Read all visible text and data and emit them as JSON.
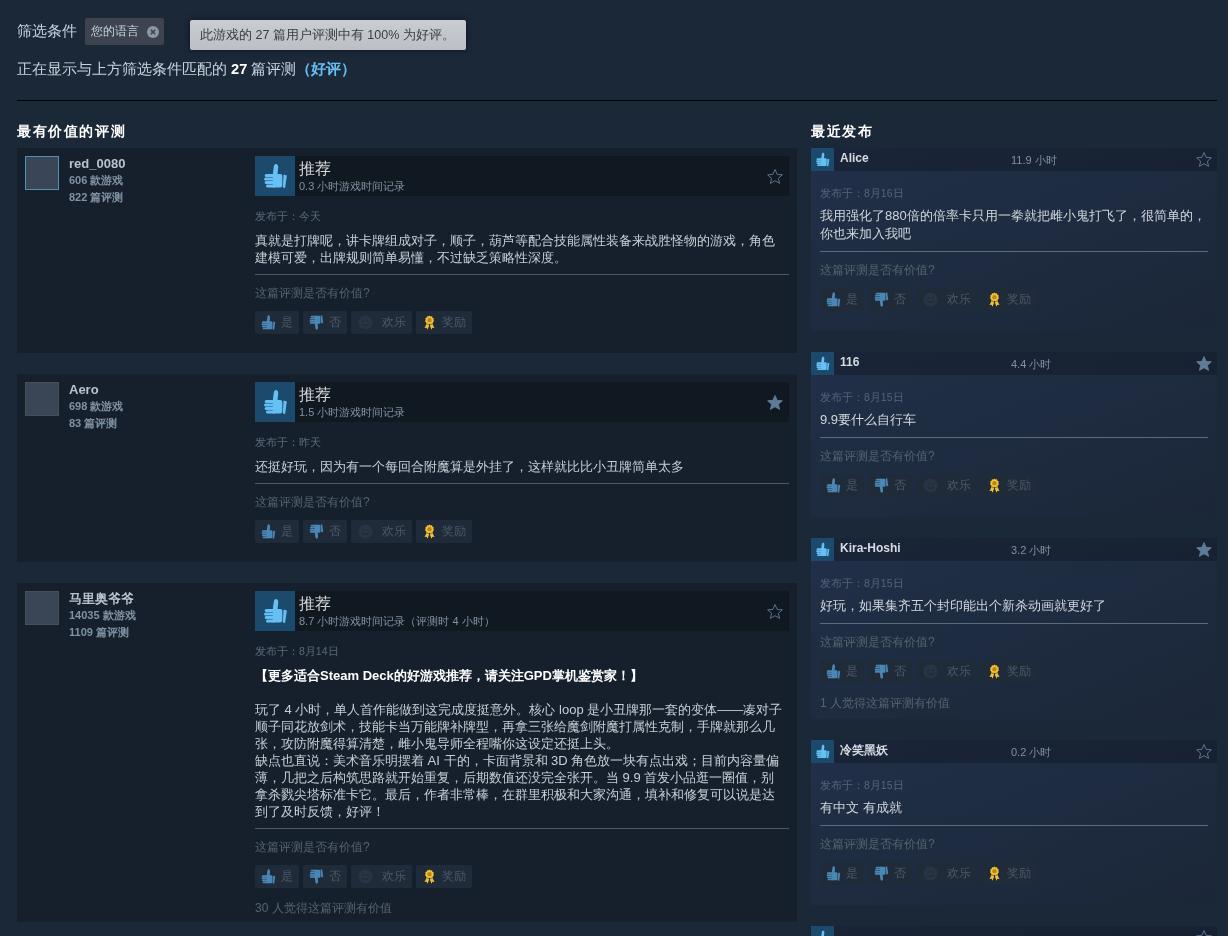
{
  "filter_bar": {
    "label": "筛选条件",
    "chips": [
      {
        "label": "您的语言"
      }
    ]
  },
  "tooltip": {
    "text": "此游戏的 27 篇用户评测中有 100% 为好评。"
  },
  "summary": {
    "text": "正在显示与上方筛选条件匹配的 **27** 篇评测",
    "score_link": "（好评）"
  },
  "most_helpful": {
    "heading": "最有价值的评测",
    "reviews": [
      {
        "author": {
          "name": "red_0080",
          "online": true,
          "games": "606 款游戏",
          "reviews": "822 篇评测"
        },
        "recommended": true,
        "verdict": "推荐",
        "playtime": "0.3 小时游戏时间记录",
        "starred": false,
        "posted": "发布于：今天",
        "paragraphs": [
          "真就是打牌呢，讲卡牌组成对子，顺子，葫芦等配合技能属性装备来战胜怪物的游戏，角色建模可爱，出牌规则简单易懂，不过缺乏策略性深度。"
        ],
        "question": "这篇评测是否有价值?",
        "buttons": [
          {
            "kind": "yes",
            "label": "是"
          },
          {
            "kind": "no",
            "label": "否"
          },
          {
            "kind": "funny",
            "label": "欢乐"
          },
          {
            "kind": "award",
            "label": "奖励"
          }
        ]
      },
      {
        "author": {
          "name": "Aero",
          "online": false,
          "games": "698 款游戏",
          "reviews": "83 篇评测"
        },
        "recommended": true,
        "verdict": "推荐",
        "playtime": "1.5 小时游戏时间记录",
        "starred": true,
        "posted": "发布于：昨天",
        "paragraphs": [
          "还挺好玩，因为有一个每回合附魔算是外挂了，这样就比比小丑牌简单太多"
        ],
        "question": "这篇评测是否有价值?",
        "buttons": [
          {
            "kind": "yes",
            "label": "是"
          },
          {
            "kind": "no",
            "label": "否"
          },
          {
            "kind": "funny",
            "label": "欢乐"
          },
          {
            "kind": "award",
            "label": "奖励"
          }
        ]
      },
      {
        "author": {
          "name": "马里奥爷爷",
          "online": false,
          "games": "14035 款游戏",
          "reviews": "1109 篇评测"
        },
        "recommended": true,
        "verdict": "推荐",
        "playtime": "8.7 小时游戏时间记录（评测时 4 小时）",
        "starred": false,
        "posted": "发布于：8月14日",
        "headline": "【更多适合Steam Deck的好游戏推荐，请关注GPD掌机鉴赏家！】",
        "paragraphs": [
          "玩了 4 小时，单人首作能做到这完成度挺意外。核心 loop 是小丑牌那一套的变体——凑对子顺子同花放剑术，技能卡当万能牌补牌型，再拿三张给魔剑附魔打属性克制，手牌就那么几张，攻防附魔得算清楚，雌小鬼导师全程嘴你这设定还挺上头。",
          "缺点也直说：美术音乐明摆着 AI 干的，卡面背景和 3D 角色放一块有点出戏；目前内容量偏薄，几把之后构筑思路就开始重复，后期数值还没完全张开。当 9.9 首发小品逛一圈值，别拿杀戮尖塔标准卡它。最后，作者非常棒，在群里积极和大家沟通，填补和修复可以说是达到了及时反馈，好评！"
        ],
        "question": "这篇评测是否有价值?",
        "buttons": [
          {
            "kind": "yes",
            "label": "是"
          },
          {
            "kind": "no",
            "label": "否"
          },
          {
            "kind": "funny",
            "label": "欢乐"
          },
          {
            "kind": "award",
            "label": "奖励"
          }
        ],
        "helpful_count": "30 人觉得这篇评测有价值"
      }
    ]
  },
  "recent": {
    "heading": "最近发布",
    "reviews": [
      {
        "author": "Alice",
        "recommended": true,
        "hours": "11.9 小时",
        "starred": false,
        "posted": "发布于：8月16日",
        "text": "我用强化了880倍的倍率卡只用一拳就把雌小鬼打飞了，很简单的，你也来加入我吧",
        "question": "这篇评测是否有价值?",
        "buttons": [
          {
            "kind": "yes",
            "label": "是"
          },
          {
            "kind": "no",
            "label": "否"
          },
          {
            "kind": "funny",
            "label": "欢乐"
          },
          {
            "kind": "award",
            "label": "奖励"
          }
        ]
      },
      {
        "author": "116",
        "recommended": true,
        "hours": "4.4 小时",
        "starred": true,
        "posted": "发布于：8月15日",
        "text": "9.9要什么自行车",
        "question": "这篇评测是否有价值?",
        "buttons": [
          {
            "kind": "yes",
            "label": "是"
          },
          {
            "kind": "no",
            "label": "否"
          },
          {
            "kind": "funny",
            "label": "欢乐"
          },
          {
            "kind": "award",
            "label": "奖励"
          }
        ]
      },
      {
        "author": "Kira-Hoshi",
        "recommended": true,
        "hours": "3.2 小时",
        "starred": true,
        "posted": "发布于：8月15日",
        "text": "好玩，如果集齐五个封印能出个新杀动画就更好了",
        "question": "这篇评测是否有价值?",
        "buttons": [
          {
            "kind": "yes",
            "label": "是"
          },
          {
            "kind": "no",
            "label": "否"
          },
          {
            "kind": "funny",
            "label": "欢乐"
          },
          {
            "kind": "award",
            "label": "奖励"
          }
        ],
        "helpful_count": "1 人觉得这篇评测有价值"
      },
      {
        "author": "冷笑黑妖",
        "recommended": true,
        "hours": "0.2 小时",
        "starred": false,
        "posted": "发布于：8月15日",
        "text": "有中文 有成就",
        "question": "这篇评测是否有价值?",
        "buttons": [
          {
            "kind": "yes",
            "label": "是"
          },
          {
            "kind": "no",
            "label": "否"
          },
          {
            "kind": "funny",
            "label": "欢乐"
          },
          {
            "kind": "award",
            "label": "奖励"
          }
        ]
      },
      {
        "recommended": true,
        "starred": false
      }
    ]
  }
}
